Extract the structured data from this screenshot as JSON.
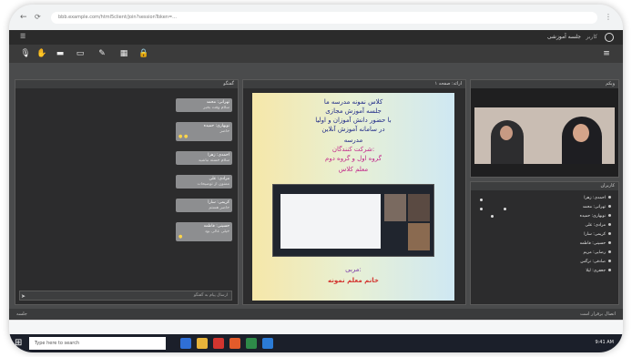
{
  "browser": {
    "url": "bbb.example.com/html5client/join?sessionToken=..."
  },
  "app": {
    "title": "جلسه آموزشی",
    "account": "کاربر"
  },
  "toolbar": {
    "icons": [
      "mic-icon",
      "hand-icon",
      "camera-icon",
      "screen-icon",
      "pen-icon",
      "grid-icon",
      "lock-icon"
    ]
  },
  "chat": {
    "title": "گفتگو",
    "messages": [
      {
        "name": "تهرانی: محمد",
        "text": "سلام وقت بخیر"
      },
      {
        "name": "نوبهاری: حمیده",
        "text": "حاضر"
      },
      {
        "name": "احمدی: زهرا",
        "text": "سلام خسته نباشید"
      },
      {
        "name": "مرادی: علی",
        "text": "ممنون از توضیحات"
      },
      {
        "name": "کریمی: سارا",
        "text": "حاضر هستم"
      },
      {
        "name": "حسینی: فاطمه",
        "text": "خیلی عالی بود"
      }
    ],
    "input_placeholder": "ارسال پیام به گفتگو"
  },
  "presentation": {
    "header": "ارائه: صفحه ۱",
    "lines": [
      "کلاس نمونه مدرسه ما",
      "جلسه آموزش مجازی",
      "با حضور دانش آموزان و اولیا",
      "در سامانه آموزش آنلاین",
      "مدرسه",
      "شرکت کنندگان:",
      "گروه اول و گروه دوم",
      "معلم کلاس"
    ],
    "footer_label": "مربی:",
    "footer_name": "خانم معلم نمونه"
  },
  "video": {
    "title": "وبکم"
  },
  "participants": {
    "title": "کاربران",
    "list": [
      "احمدی: زهرا",
      "تهرانی: محمد",
      "نوبهاری: حمیده",
      "مرادی: علی",
      "کریمی: سارا",
      "حسینی: فاطمه",
      "رضایی: مریم",
      "صادقی: نرگس",
      "جعفری: لیلا"
    ]
  },
  "status": {
    "bottom_left": "جلسه",
    "bottom_right": "اتصال برقرار است"
  },
  "taskbar": {
    "search_placeholder": "Type here to search",
    "time": "9:41 AM"
  },
  "colors": {
    "accent": "#d3352f",
    "slide_text": "#1f2a88",
    "panel": "#2c2c2d",
    "app_bg": "#4a4b4c"
  }
}
